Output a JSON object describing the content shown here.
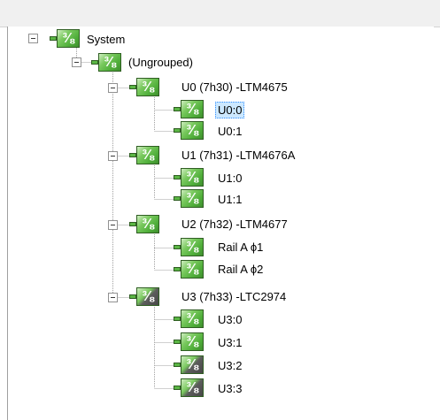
{
  "tree": {
    "root": {
      "label": "System",
      "icon": "power-supply-icon"
    },
    "group": {
      "label": "(Ungrouped)",
      "icon": "power-supply-icon"
    },
    "devices": [
      {
        "label": "U0 (7h30) -LTM4675",
        "channels": [
          {
            "label": "U0:0",
            "selected": true
          },
          {
            "label": "U0:1"
          }
        ]
      },
      {
        "label": "U1 (7h31) -LTM4676A",
        "channels": [
          {
            "label": "U1:0"
          },
          {
            "label": "U1:1"
          }
        ]
      },
      {
        "label": "U2 (7h32) -LTM4677",
        "channels": [
          {
            "label": "Rail A ϕ1"
          },
          {
            "label": "Rail A ϕ2"
          }
        ]
      },
      {
        "label": "U3 (7h33) -LTC2974",
        "icon_state": "disabled",
        "channels": [
          {
            "label": "U3:0"
          },
          {
            "label": "U3:1"
          },
          {
            "label": "U3:2",
            "icon_state": "disabled"
          },
          {
            "label": "U3:3",
            "icon_state": "disabled"
          }
        ]
      }
    ]
  },
  "colors": {
    "icon_green": "#4fae3a",
    "icon_dark": "#474747",
    "selection_bg": "#cce8ff",
    "selection_border": "#3390ff"
  }
}
